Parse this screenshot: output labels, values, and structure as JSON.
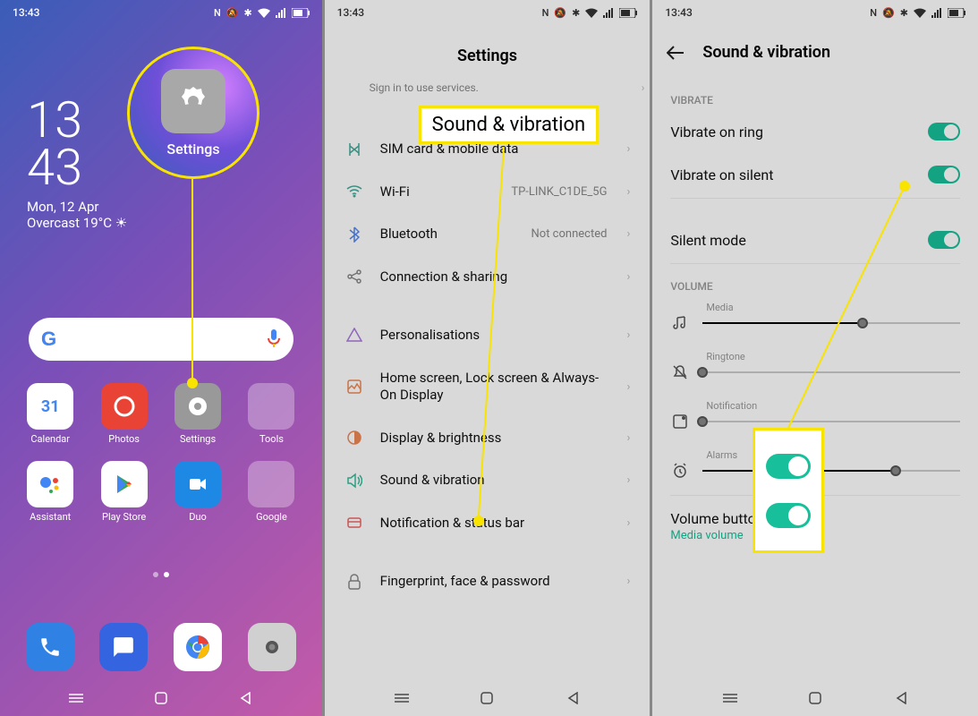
{
  "status": {
    "time": "13:43"
  },
  "screen1": {
    "clock_h": "13",
    "clock_m": "43",
    "date": "Mon, 12 Apr",
    "weather": "Overcast 19°C",
    "apps": {
      "calendar": "Calendar",
      "photos": "Photos",
      "settings": "Settings",
      "tools": "Tools",
      "assistant": "Assistant",
      "playstore": "Play Store",
      "duo": "Duo",
      "google": "Google"
    },
    "zoom_label": "Settings"
  },
  "screen2": {
    "title": "Settings",
    "profile_sub": "Sign in to use services.",
    "rows": {
      "sim": {
        "label": "SIM card & mobile data"
      },
      "wifi": {
        "label": "Wi-Fi",
        "value": "TP-LINK_C1DE_5G"
      },
      "bluetooth": {
        "label": "Bluetooth",
        "value": "Not connected"
      },
      "connection": {
        "label": "Connection & sharing"
      },
      "personal": {
        "label": "Personalisations"
      },
      "home": {
        "label": "Home screen, Lock screen & Always-On Display"
      },
      "display": {
        "label": "Display & brightness"
      },
      "sound": {
        "label": "Sound & vibration"
      },
      "notification": {
        "label": "Notification & status bar"
      },
      "fingerprint": {
        "label": "Fingerprint, face & password"
      }
    },
    "callout_text": "Sound & vibration"
  },
  "screen3": {
    "title": "Sound & vibration",
    "section_vibrate": "VIBRATE",
    "vibrate_ring": "Vibrate on ring",
    "vibrate_silent": "Vibrate on silent",
    "silent_mode": "Silent mode",
    "section_volume": "VOLUME",
    "sliders": {
      "media": "Media",
      "ringtone": "Ringtone",
      "notification": "Notification",
      "alarms": "Alarms"
    },
    "bottom_title": "Volume button function",
    "bottom_sub": "Media volume"
  }
}
